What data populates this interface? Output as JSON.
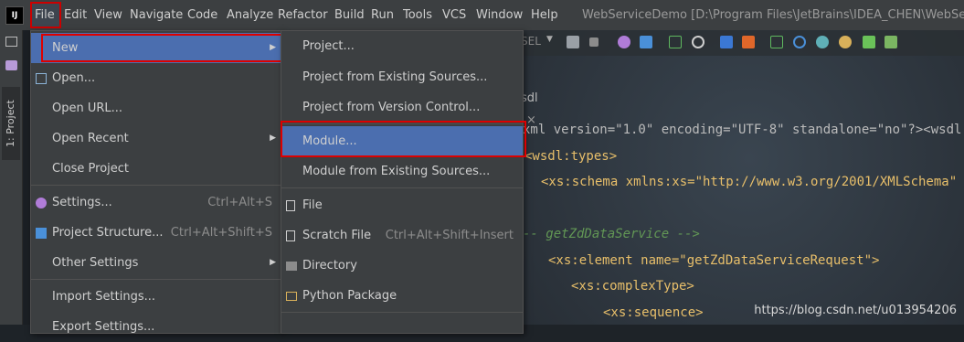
{
  "menubar": {
    "logo": "IJ",
    "items": [
      "File",
      "Edit",
      "View",
      "Navigate",
      "Code",
      "Analyze",
      "Refactor",
      "Build",
      "Run",
      "Tools",
      "VCS",
      "Window",
      "Help"
    ],
    "title": "WebServiceDemo [D:\\Program Files\\JetBrains\\IDEA_CHEN\\WebServiceD"
  },
  "toolbar": {
    "run_config": "SEL"
  },
  "sidebar": {
    "project_tab": "1: Project"
  },
  "editor_tab": {
    "label": "sdl",
    "close": "×"
  },
  "code_lines": [
    {
      "text": "xml version=\"1.0\" encoding=\"UTF-8\" standalone=\"no\"?><wsdl"
    },
    {
      "text": "<wsdl:types>"
    },
    {
      "text": "<xs:schema xmlns:xs=\"http://www.w3.org/2001/XMLSchema\""
    },
    {
      "text": "-- getZdDataService -->"
    },
    {
      "text": "<xs:element name=\"getZdDataServiceRequest\">"
    },
    {
      "text": "<xs:complexType>"
    },
    {
      "text": "<xs:sequence>"
    }
  ],
  "file_menu": {
    "items": [
      {
        "label": "New",
        "shortcut": "",
        "submenu": true,
        "icon": ""
      },
      {
        "label": "Open...",
        "shortcut": "",
        "submenu": false,
        "icon": "folder-icon"
      },
      {
        "label": "Open URL...",
        "shortcut": "",
        "submenu": false,
        "icon": ""
      },
      {
        "label": "Open Recent",
        "shortcut": "",
        "submenu": true,
        "icon": ""
      },
      {
        "label": "Close Project",
        "shortcut": "",
        "submenu": false,
        "icon": ""
      },
      {
        "label": "Settings...",
        "shortcut": "Ctrl+Alt+S",
        "submenu": false,
        "icon": "gear-icon"
      },
      {
        "label": "Project Structure...",
        "shortcut": "Ctrl+Alt+Shift+S",
        "submenu": false,
        "icon": "grid-icon"
      },
      {
        "label": "Other Settings",
        "shortcut": "",
        "submenu": true,
        "icon": ""
      },
      {
        "label": "Import Settings...",
        "shortcut": "",
        "submenu": false,
        "icon": ""
      },
      {
        "label": "Export Settings...",
        "shortcut": "",
        "submenu": false,
        "icon": ""
      }
    ]
  },
  "new_submenu": {
    "items": [
      {
        "label": "Project...",
        "shortcut": "",
        "icon": ""
      },
      {
        "label": "Project from Existing Sources...",
        "shortcut": "",
        "icon": ""
      },
      {
        "label": "Project from Version Control...",
        "shortcut": "",
        "icon": ""
      },
      {
        "label": "Module...",
        "shortcut": "",
        "icon": ""
      },
      {
        "label": "Module from Existing Sources...",
        "shortcut": "",
        "icon": ""
      },
      {
        "label": "File",
        "shortcut": "",
        "icon": "file-icon"
      },
      {
        "label": "Scratch File",
        "shortcut": "Ctrl+Alt+Shift+Insert",
        "icon": "scratch-file-icon"
      },
      {
        "label": "Directory",
        "shortcut": "",
        "icon": "folder-icon"
      },
      {
        "label": "Python Package",
        "shortcut": "",
        "icon": "package-icon"
      }
    ]
  },
  "watermark": "https://blog.csdn.net/u013954206",
  "colors": {
    "menu_bg": "#3c3f41",
    "highlight": "#4b6eaf",
    "annotation_red": "#dd0000"
  }
}
